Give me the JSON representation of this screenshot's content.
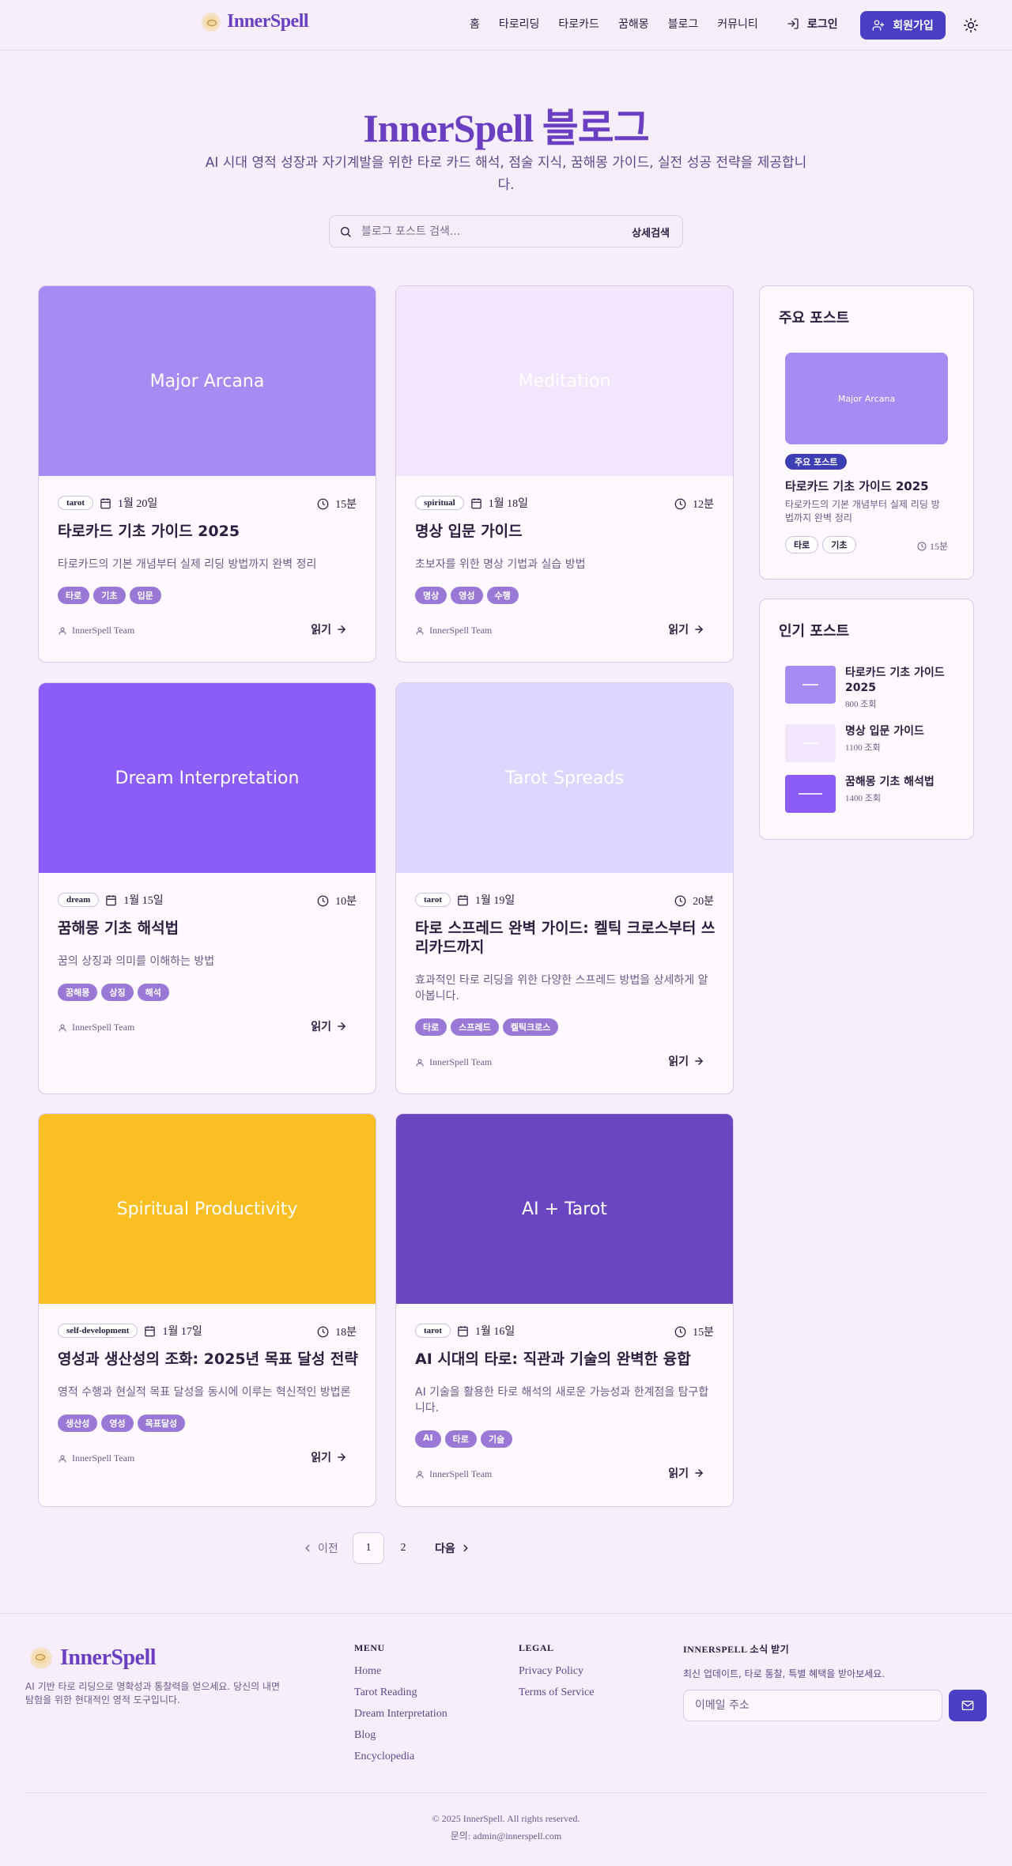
{
  "header": {
    "brand": "InnerSpell",
    "nav": [
      "홈",
      "타로리딩",
      "타로카드",
      "꿈해몽",
      "블로그",
      "커뮤니티"
    ],
    "login_label": "로그인",
    "signup_label": "회원가입"
  },
  "hero": {
    "title": "InnerSpell 블로그",
    "subtitle": "AI 시대 영적 성장과 자기계발을 위한 타로 카드 해석, 점술 지식, 꿈해몽 가이드, 실전 성공 전략을 제공합니다.",
    "search_placeholder": "블로그 포스트 검색...",
    "advanced_label": "상세검색"
  },
  "posts": [
    {
      "image_label": "Major Arcana",
      "image_color": "#a78bf2",
      "category": "tarot",
      "date": "1월 20일",
      "read_time": "15분",
      "title": "타로카드 기초 가이드 2025",
      "desc": "타로카드의 기본 개념부터 실제 리딩 방법까지 완벽 정리",
      "tags": [
        "타로",
        "기초",
        "입문"
      ],
      "author": "InnerSpell Team",
      "read_label": "읽기"
    },
    {
      "image_label": "Meditation",
      "image_color": "#f2e6fc",
      "category": "spiritual",
      "date": "1월 18일",
      "read_time": "12분",
      "title": "명상 입문 가이드",
      "desc": "초보자를 위한 명상 기법과 실습 방법",
      "tags": [
        "명상",
        "영성",
        "수행"
      ],
      "author": "InnerSpell Team",
      "read_label": "읽기"
    },
    {
      "image_label": "Dream Interpretation",
      "image_color": "#8b5cf6",
      "category": "dream",
      "date": "1월 15일",
      "read_time": "10분",
      "title": "꿈해몽 기초 해석법",
      "desc": "꿈의 상징과 의미를 이해하는 방법",
      "tags": [
        "꿈해몽",
        "상징",
        "해석"
      ],
      "author": "InnerSpell Team",
      "read_label": "읽기"
    },
    {
      "image_label": "Tarot Spreads",
      "image_color": "#ddd6fe",
      "category": "tarot",
      "date": "1월 19일",
      "read_time": "20분",
      "title": "타로 스프레드 완벽 가이드: 켈틱 크로스부터 쓰리카드까지",
      "desc": "효과적인 타로 리딩을 위한 다양한 스프레드 방법을 상세하게 알아봅니다.",
      "tags": [
        "타로",
        "스프레드",
        "켈틱크로스"
      ],
      "author": "InnerSpell Team",
      "read_label": "읽기"
    },
    {
      "image_label": "Spiritual Productivity",
      "image_color": "#fbbf24",
      "category": "self-development",
      "date": "1월 17일",
      "read_time": "18분",
      "title": "영성과 생산성의 조화: 2025년 목표 달성 전략",
      "desc": "영적 수행과 현실적 목표 달성을 동시에 이루는 혁신적인 방법론",
      "tags": [
        "생산성",
        "영성",
        "목표달성"
      ],
      "author": "InnerSpell Team",
      "read_label": "읽기"
    },
    {
      "image_label": "AI + Tarot",
      "image_color": "#6a46c1",
      "category": "tarot",
      "date": "1월 16일",
      "read_time": "15분",
      "title": "AI 시대의 타로: 직관과 기술의 완벽한 융합",
      "desc": "AI 기술을 활용한 타로 해석의 새로운 가능성과 한계점을 탐구합니다.",
      "tags": [
        "AI",
        "타로",
        "기술"
      ],
      "author": "InnerSpell Team",
      "read_label": "읽기"
    }
  ],
  "sidebar": {
    "featured": {
      "heading": "주요 포스트",
      "image_label": "Major Arcana",
      "badge": "주요 포스트",
      "title": "타로카드 기초 가이드 2025",
      "desc": "타로카드의 기본 개념부터 실제 리딩 방법까지 완벽 정리",
      "tags": [
        "타로",
        "기초"
      ],
      "read_time": "15분"
    },
    "popular": {
      "heading": "인기 포스트",
      "items": [
        {
          "title": "타로카드 기초 가이드 2025",
          "views": "800 조회",
          "color": "#a78bf2"
        },
        {
          "title": "명상 입문 가이드",
          "views": "1100 조회",
          "color": "#f2e6fc"
        },
        {
          "title": "꿈해몽 기초 해석법",
          "views": "1400 조회",
          "color": "#8b5cf6"
        }
      ]
    }
  },
  "pagination": {
    "prev": "이전",
    "pages": [
      "1",
      "2"
    ],
    "next": "다음",
    "current": "1"
  },
  "footer": {
    "brand": "InnerSpell",
    "desc": "AI 기반 타로 리딩으로 명확성과 통찰력을 얻으세요. 당신의 내면 탐험을 위한 현대적인 영적 도구입니다.",
    "menu_heading": "MENU",
    "menu": [
      "Home",
      "Tarot Reading",
      "Dream Interpretation",
      "Blog",
      "Encyclopedia"
    ],
    "legal_heading": "LEGAL",
    "legal": [
      "Privacy Policy",
      "Terms of Service"
    ],
    "news_heading": "INNERSPELL 소식 받기",
    "news_desc": "최신 업데이트, 타로 통찰, 특별 혜택을 받아보세요.",
    "email_placeholder": "이메일 주소",
    "copyright": "© 2025 InnerSpell. All rights reserved.",
    "contact": "문의: admin@innerspell.com"
  }
}
